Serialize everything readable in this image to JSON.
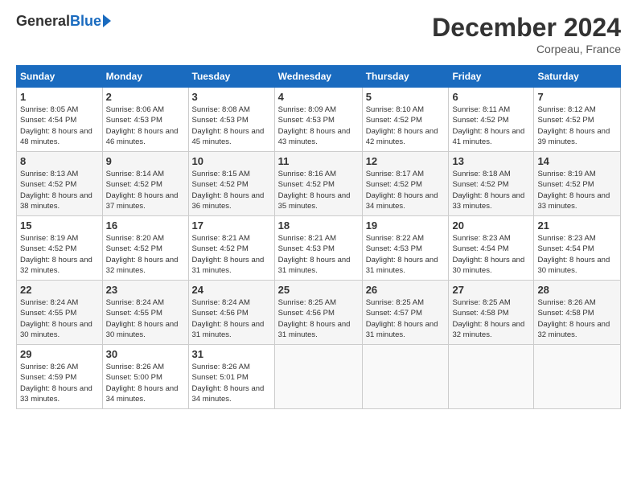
{
  "header": {
    "logo_general": "General",
    "logo_blue": "Blue",
    "title": "December 2024",
    "location": "Corpeau, France"
  },
  "calendar": {
    "days_of_week": [
      "Sunday",
      "Monday",
      "Tuesday",
      "Wednesday",
      "Thursday",
      "Friday",
      "Saturday"
    ],
    "weeks": [
      [
        null,
        {
          "day": "2",
          "sunrise": "8:06 AM",
          "sunset": "4:53 PM",
          "daylight": "8 hours and 46 minutes."
        },
        {
          "day": "3",
          "sunrise": "8:08 AM",
          "sunset": "4:53 PM",
          "daylight": "8 hours and 45 minutes."
        },
        {
          "day": "4",
          "sunrise": "8:09 AM",
          "sunset": "4:53 PM",
          "daylight": "8 hours and 43 minutes."
        },
        {
          "day": "5",
          "sunrise": "8:10 AM",
          "sunset": "4:52 PM",
          "daylight": "8 hours and 42 minutes."
        },
        {
          "day": "6",
          "sunrise": "8:11 AM",
          "sunset": "4:52 PM",
          "daylight": "8 hours and 41 minutes."
        },
        {
          "day": "7",
          "sunrise": "8:12 AM",
          "sunset": "4:52 PM",
          "daylight": "8 hours and 39 minutes."
        }
      ],
      [
        {
          "day": "1",
          "sunrise": "8:05 AM",
          "sunset": "4:54 PM",
          "daylight": "8 hours and 48 minutes."
        },
        {
          "day": "8",
          "sunrise": "8:13 AM",
          "sunset": "4:52 PM",
          "daylight": "8 hours and 38 minutes."
        },
        {
          "day": "9",
          "sunrise": "8:14 AM",
          "sunset": "4:52 PM",
          "daylight": "8 hours and 37 minutes."
        },
        {
          "day": "10",
          "sunrise": "8:15 AM",
          "sunset": "4:52 PM",
          "daylight": "8 hours and 36 minutes."
        },
        {
          "day": "11",
          "sunrise": "8:16 AM",
          "sunset": "4:52 PM",
          "daylight": "8 hours and 35 minutes."
        },
        {
          "day": "12",
          "sunrise": "8:17 AM",
          "sunset": "4:52 PM",
          "daylight": "8 hours and 34 minutes."
        },
        {
          "day": "13",
          "sunrise": "8:18 AM",
          "sunset": "4:52 PM",
          "daylight": "8 hours and 33 minutes."
        },
        {
          "day": "14",
          "sunrise": "8:19 AM",
          "sunset": "4:52 PM",
          "daylight": "8 hours and 33 minutes."
        }
      ],
      [
        {
          "day": "15",
          "sunrise": "8:19 AM",
          "sunset": "4:52 PM",
          "daylight": "8 hours and 32 minutes."
        },
        {
          "day": "16",
          "sunrise": "8:20 AM",
          "sunset": "4:52 PM",
          "daylight": "8 hours and 32 minutes."
        },
        {
          "day": "17",
          "sunrise": "8:21 AM",
          "sunset": "4:52 PM",
          "daylight": "8 hours and 31 minutes."
        },
        {
          "day": "18",
          "sunrise": "8:21 AM",
          "sunset": "4:53 PM",
          "daylight": "8 hours and 31 minutes."
        },
        {
          "day": "19",
          "sunrise": "8:22 AM",
          "sunset": "4:53 PM",
          "daylight": "8 hours and 31 minutes."
        },
        {
          "day": "20",
          "sunrise": "8:23 AM",
          "sunset": "4:54 PM",
          "daylight": "8 hours and 30 minutes."
        },
        {
          "day": "21",
          "sunrise": "8:23 AM",
          "sunset": "4:54 PM",
          "daylight": "8 hours and 30 minutes."
        }
      ],
      [
        {
          "day": "22",
          "sunrise": "8:24 AM",
          "sunset": "4:55 PM",
          "daylight": "8 hours and 30 minutes."
        },
        {
          "day": "23",
          "sunrise": "8:24 AM",
          "sunset": "4:55 PM",
          "daylight": "8 hours and 30 minutes."
        },
        {
          "day": "24",
          "sunrise": "8:24 AM",
          "sunset": "4:56 PM",
          "daylight": "8 hours and 31 minutes."
        },
        {
          "day": "25",
          "sunrise": "8:25 AM",
          "sunset": "4:56 PM",
          "daylight": "8 hours and 31 minutes."
        },
        {
          "day": "26",
          "sunrise": "8:25 AM",
          "sunset": "4:57 PM",
          "daylight": "8 hours and 31 minutes."
        },
        {
          "day": "27",
          "sunrise": "8:25 AM",
          "sunset": "4:58 PM",
          "daylight": "8 hours and 32 minutes."
        },
        {
          "day": "28",
          "sunrise": "8:26 AM",
          "sunset": "4:58 PM",
          "daylight": "8 hours and 32 minutes."
        }
      ],
      [
        {
          "day": "29",
          "sunrise": "8:26 AM",
          "sunset": "4:59 PM",
          "daylight": "8 hours and 33 minutes."
        },
        {
          "day": "30",
          "sunrise": "8:26 AM",
          "sunset": "5:00 PM",
          "daylight": "8 hours and 34 minutes."
        },
        {
          "day": "31",
          "sunrise": "8:26 AM",
          "sunset": "5:01 PM",
          "daylight": "8 hours and 34 minutes."
        },
        null,
        null,
        null,
        null
      ]
    ]
  }
}
